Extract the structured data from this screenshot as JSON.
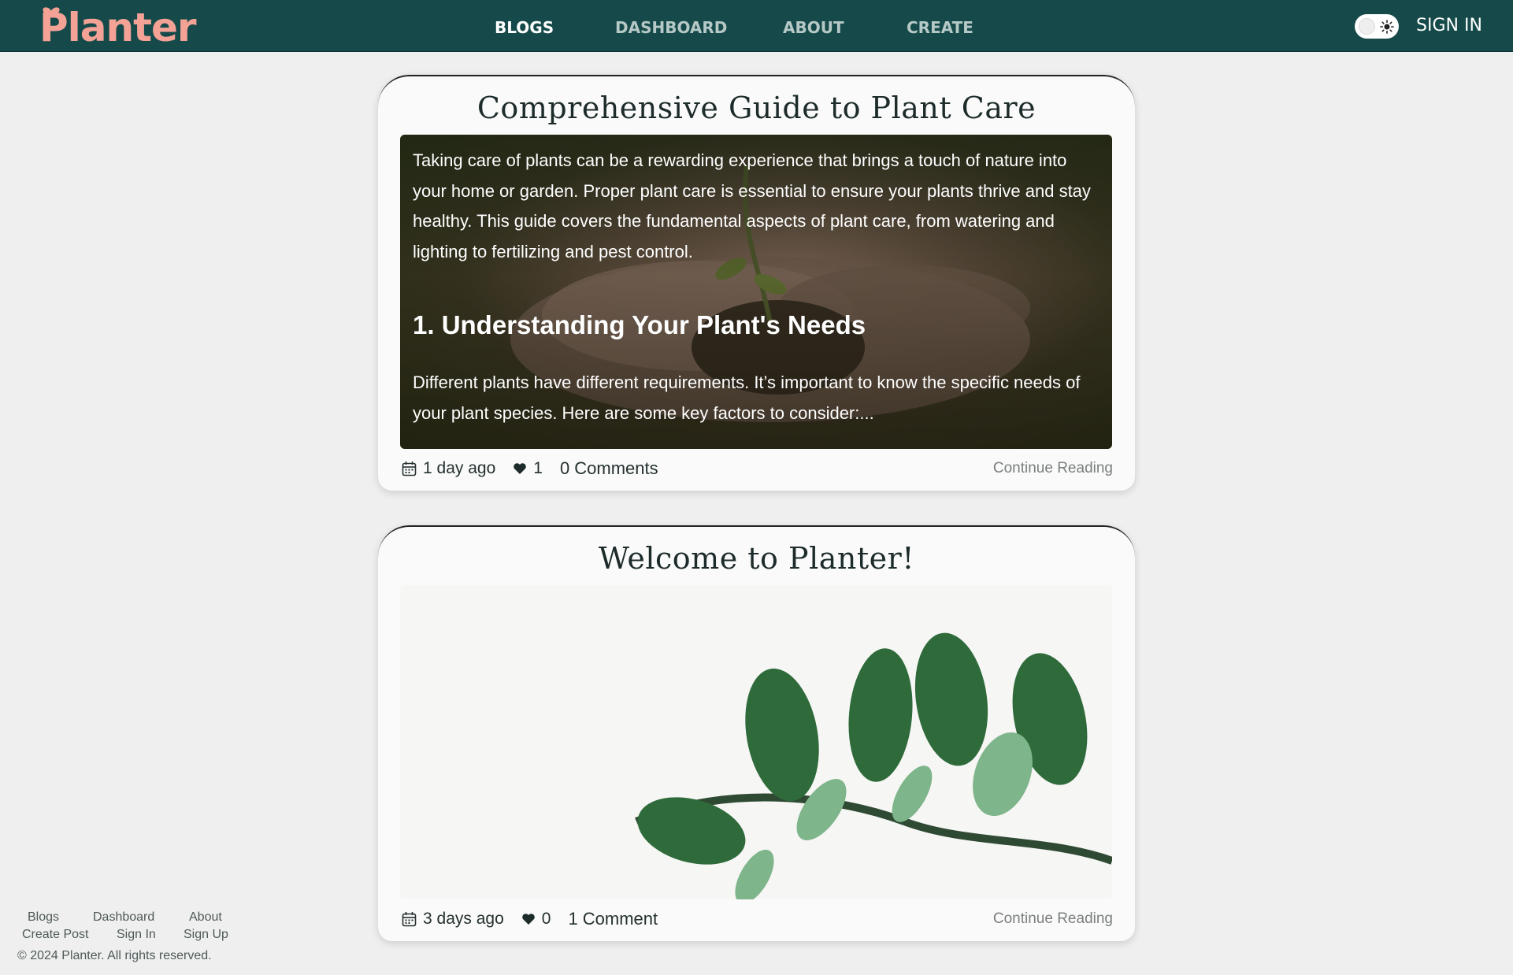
{
  "nav": {
    "logo": "Planter",
    "links": [
      "BLOGS",
      "DASHBOARD",
      "ABOUT",
      "CREATE"
    ],
    "active": "BLOGS",
    "sign_in": "SIGN IN",
    "theme_toggle_icon": "sun-icon"
  },
  "colors": {
    "nav_bg": "#164a4a",
    "logo": "#f4a296",
    "page_bg": "#efefef"
  },
  "posts": [
    {
      "title": "Comprehensive Guide to Plant Care",
      "intro": "Taking care of plants can be a rewarding experience that brings a touch of nature into your home or garden. Proper plant care is essential to ensure your plants thrive and stay healthy. This guide covers the fundamental aspects of plant care, from watering and lighting to fertilizing and pest control.",
      "heading": "1. Understanding Your Plant's Needs",
      "excerpt": "Different plants have different requirements. It’s important to know the specific needs of your plant species. Here are some key factors to consider:...",
      "image": "hands-holding-seedling-photo",
      "date": "1 day ago",
      "likes": "1",
      "comments": "0 Comments",
      "continue": "Continue Reading"
    },
    {
      "title": "Welcome to Planter!",
      "image": "green-leafy-branch-photo",
      "date": "3 days ago",
      "likes": "0",
      "comments": "1 Comment",
      "continue": "Continue Reading"
    }
  ],
  "footer": {
    "links_row1": [
      "Blogs",
      "Dashboard",
      "About"
    ],
    "links_row2": [
      "Create Post",
      "Sign In",
      "Sign Up"
    ],
    "copyright": "© 2024 Planter. All rights reserved."
  }
}
